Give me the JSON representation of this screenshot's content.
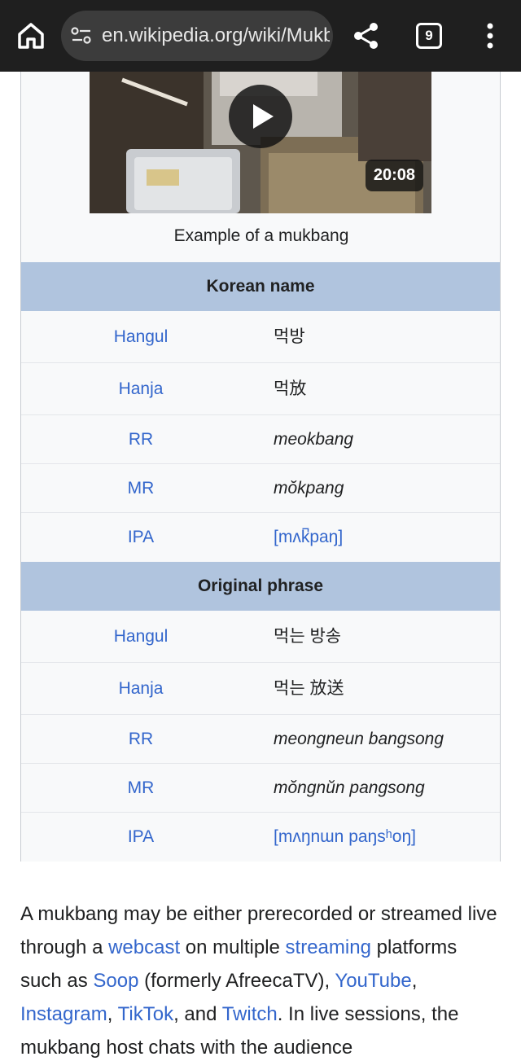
{
  "browser": {
    "url": "en.wikipedia.org/wiki/Mukb",
    "tab_count": "9"
  },
  "infobox": {
    "video_duration": "20:08",
    "caption": "Example of a mukbang",
    "korean_name": {
      "header": "Korean name",
      "rows": [
        {
          "label": "Hangul",
          "value": "먹방"
        },
        {
          "label": "Hanja",
          "value": "먹放"
        },
        {
          "label": "RR",
          "value": "meokbang"
        },
        {
          "label": "MR",
          "value": "mŏkpang"
        },
        {
          "label": "IPA",
          "value": "[mʌk̚paŋ]"
        }
      ]
    },
    "original_phrase": {
      "header": "Original phrase",
      "rows": [
        {
          "label": "Hangul",
          "value": "먹는 방송"
        },
        {
          "label": "Hanja",
          "value": "먹는 放送"
        },
        {
          "label": "RR",
          "value": "meongneun bangsong"
        },
        {
          "label": "MR",
          "value": "mŏngnŭn pangsong"
        },
        {
          "label": "IPA",
          "value": "[mʌŋnɯn paŋsʰoŋ]"
        }
      ]
    }
  },
  "paragraph": {
    "t1": "A mukbang may be either prerecorded or streamed live through a ",
    "l1": "webcast",
    "t2": " on multiple ",
    "l2": "streaming",
    "t3": " platforms such as ",
    "l3": "Soop",
    "t4": " (formerly AfreecaTV), ",
    "l4": "YouTube",
    "t5": ", ",
    "l5": "Instagram",
    "t6": ", ",
    "l6": "TikTok",
    "t7": ", and ",
    "l7": "Twitch",
    "t8": ". In live sessions, the mukbang host chats with the audience"
  },
  "colors": {
    "link": "#3366cc",
    "header_bg": "#b0c4de",
    "topbar_bg": "#1f1f1f"
  }
}
